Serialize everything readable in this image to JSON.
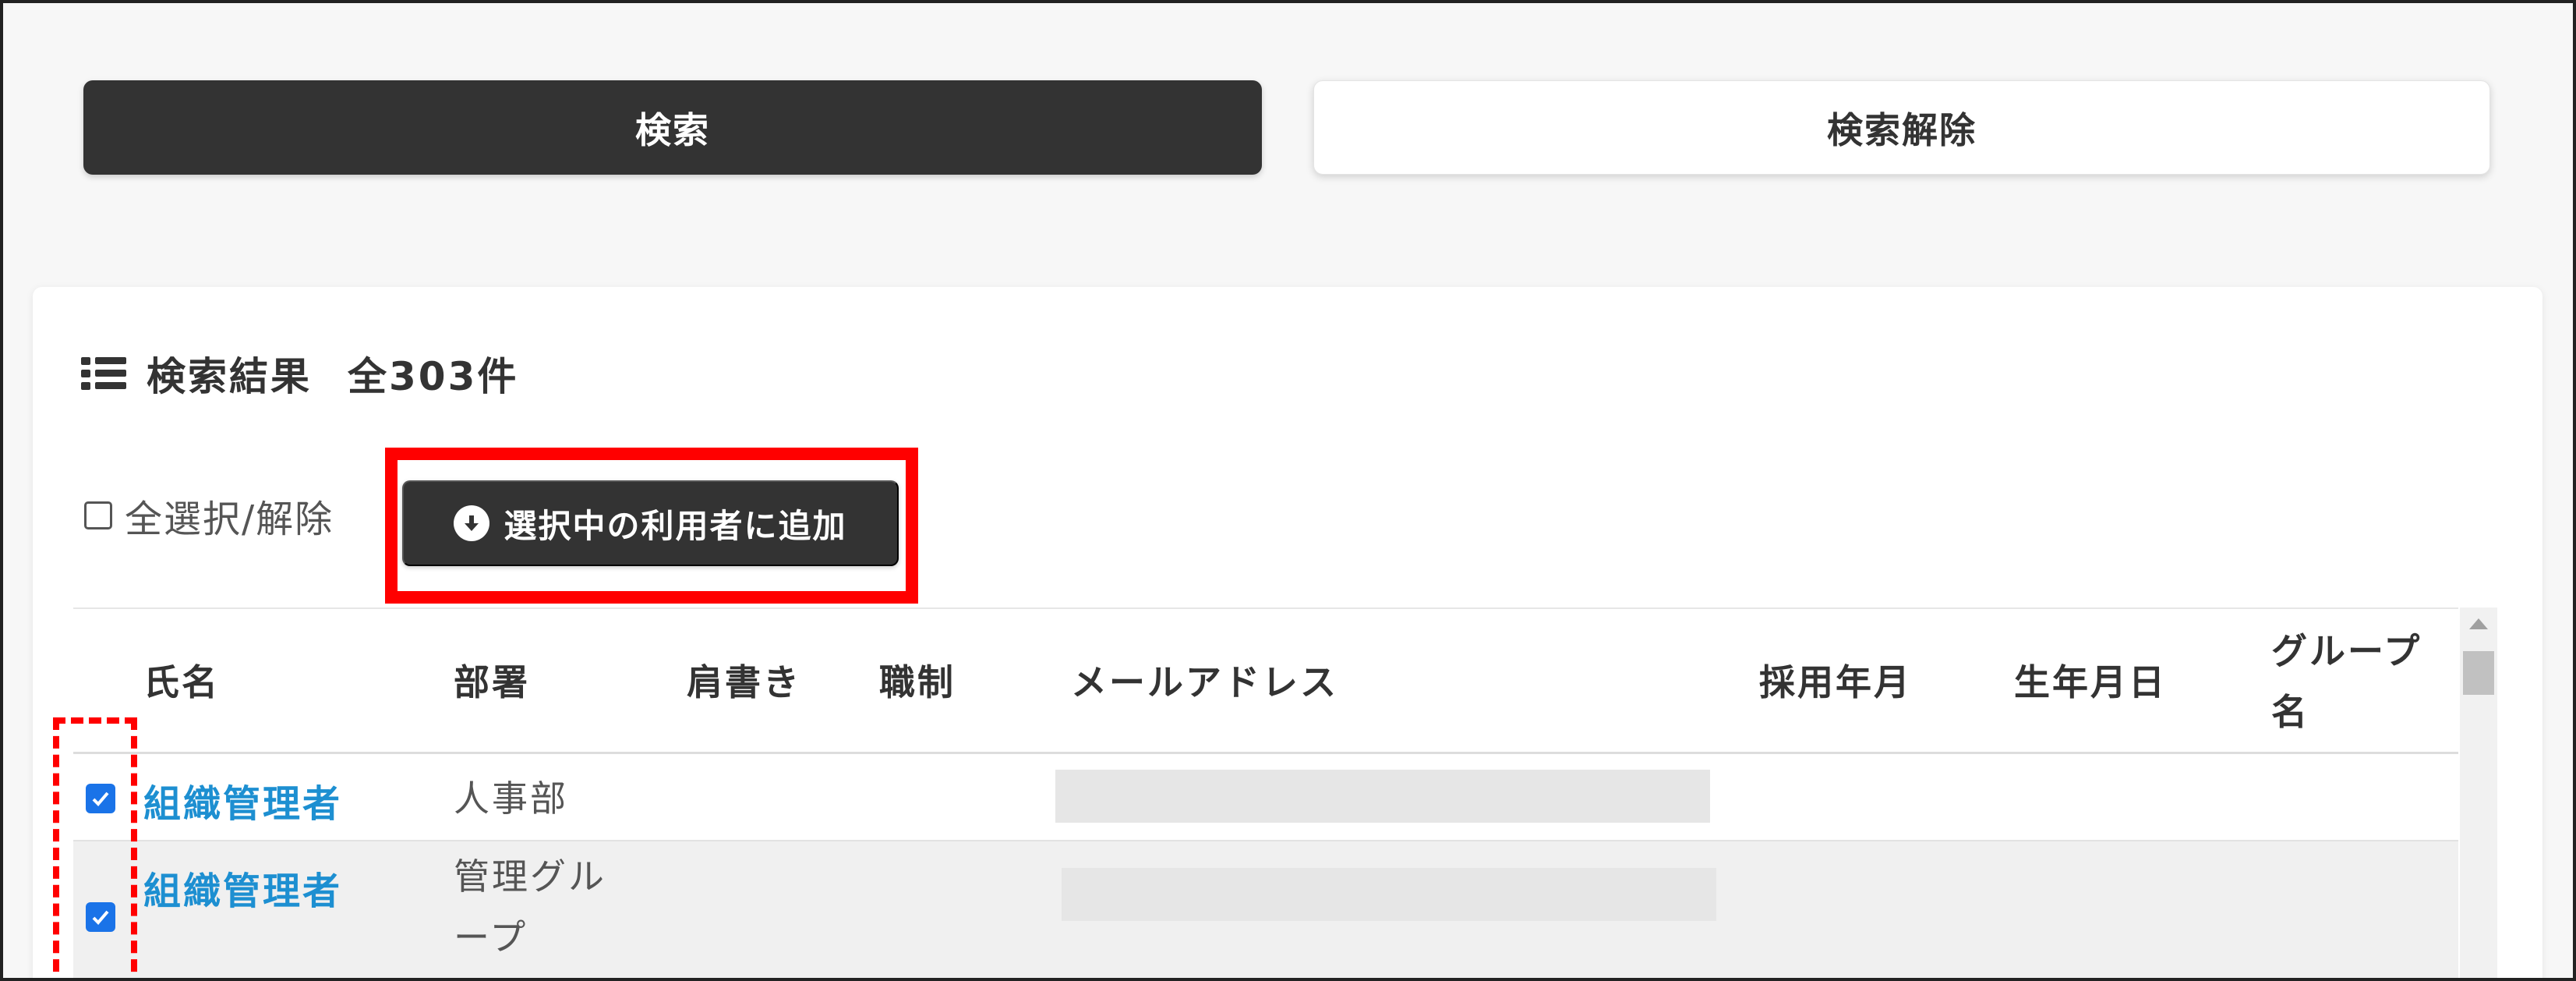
{
  "search_panel": {
    "search_label": "検索",
    "clear_label": "検索解除"
  },
  "results": {
    "title": "検索結果",
    "count": "全303件",
    "select_all_label": "全選択/解除",
    "add_selected_label": "選択中の利用者に追加"
  },
  "table": {
    "headers": {
      "name": "氏名",
      "department": "部署",
      "title": "肩書き",
      "position": "職制",
      "email": "メールアドレス",
      "hire_date": "採用年月",
      "birth_date": "生年月日",
      "group_line1": "グループ",
      "group_line2": "名"
    },
    "rows": [
      {
        "checked": true,
        "name": "組織管理者",
        "department_line1": "人事部",
        "department_line2": "",
        "email_redacted": true
      },
      {
        "checked": true,
        "name": "組織管理者",
        "department_line1": "管理グル",
        "department_line2": "ープ",
        "email_redacted": true
      }
    ]
  },
  "colors": {
    "primary_button": "#333333",
    "link": "#1d8fd1",
    "checkbox": "#1a73e8",
    "highlight": "#ff0000"
  },
  "icons": {
    "list": "list-icon",
    "download": "download-circle-icon",
    "check": "check-icon"
  }
}
